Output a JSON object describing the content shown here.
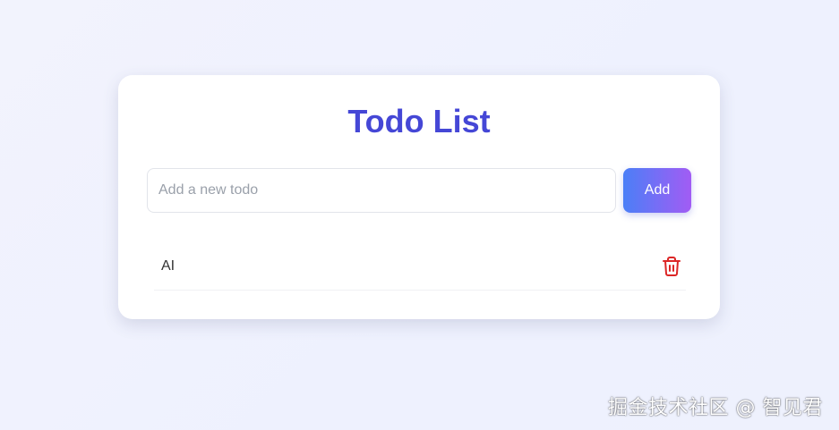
{
  "app": {
    "title": "Todo List"
  },
  "input": {
    "placeholder": "Add a new todo",
    "value": ""
  },
  "add_button": {
    "label": "Add"
  },
  "todos": [
    {
      "text": "AI",
      "delete_icon": "trash-icon"
    }
  ],
  "colors": {
    "title": "#4547d6",
    "button_gradient_start": "#4b7ff7",
    "button_gradient_end": "#a25cf4",
    "delete_icon": "#dc2626"
  },
  "watermark": {
    "text": "掘金技术社区 @ 智见君"
  }
}
